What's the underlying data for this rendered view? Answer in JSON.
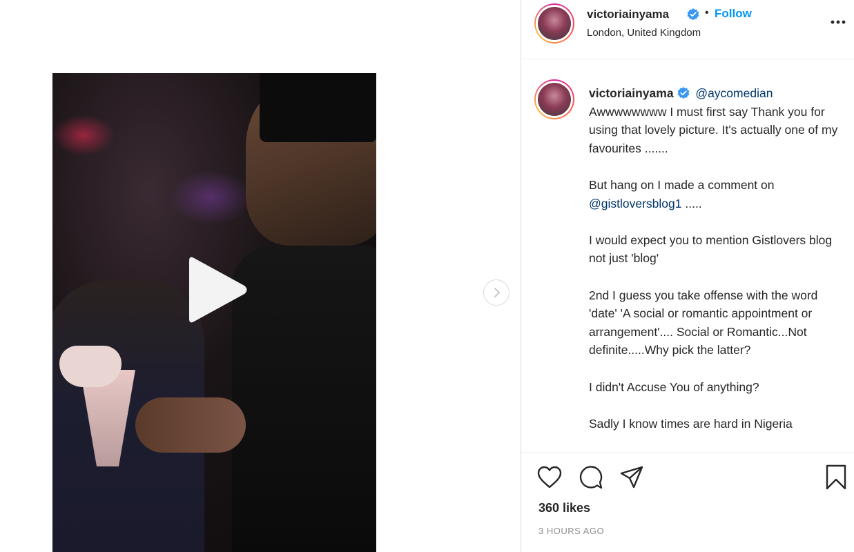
{
  "post": {
    "username": "victoriainyama",
    "follow_label": "Follow",
    "separator": "•",
    "location": "London, United Kingdom"
  },
  "comment": {
    "username": "victoriainyama",
    "mention": "@aycomedian",
    "para1": "Awwwwwwww I must first say Thank you for using that lovely picture. It's actually one of my favourites  .......",
    "para2_text": "But hang on I made a comment on",
    "para2_mention": "@gistloversblog1",
    "para2_tail": " .....",
    "para3": "I would expect you to mention Gistlovers blog not just 'blog'",
    "para4": "2nd I guess you take offense with the word 'date' 'A social or romantic appointment or arrangement'.... Social or Romantic...Not definite.....Why pick the latter?",
    "para5": "I didn't Accuse You of anything?",
    "para6": "Sadly I know times are hard in Nigeria"
  },
  "engagement": {
    "likes": "360 likes",
    "time_ago": "3 HOURS AGO"
  },
  "icons": {
    "verified": "verified-badge-icon",
    "more": "more-options-icon",
    "like": "heart-icon",
    "comment": "comment-bubble-icon",
    "share": "paper-plane-icon",
    "save": "bookmark-icon",
    "play": "play-icon",
    "next": "chevron-right-icon"
  },
  "colors": {
    "link_blue": "#0095f6",
    "mention_blue": "#00376b",
    "verified_blue": "#3897f0",
    "muted": "#8e8e8e"
  }
}
